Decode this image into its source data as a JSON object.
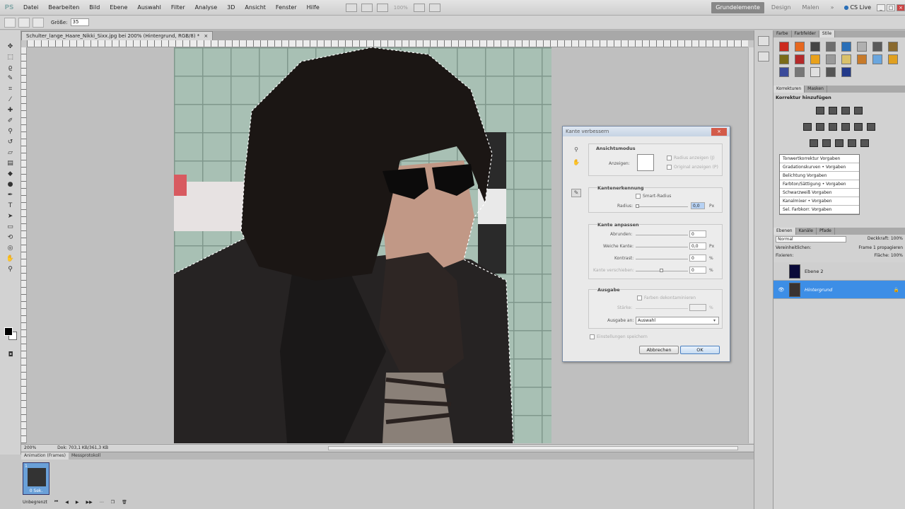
{
  "app": {
    "logo": "PS"
  },
  "menu": [
    "Datei",
    "Bearbeiten",
    "Bild",
    "Ebene",
    "Auswahl",
    "Filter",
    "Analyse",
    "3D",
    "Ansicht",
    "Fenster",
    "Hilfe"
  ],
  "menubar_zoom": "100%",
  "workspaces": {
    "active": "Grundelemente",
    "design": "Design",
    "malen": "Malen",
    "more": "»"
  },
  "cslive": "CS Live",
  "options": {
    "size_label": "Größe:",
    "size_value": "35"
  },
  "document": {
    "tab_title": "Schulter_lange_Haare_Nikki_Sixx.jpg bei 200% (Hintergrund, RGB/8) *",
    "close": "×"
  },
  "status": {
    "zoom": "200%",
    "doc": "Dok: 703,1 KB/361,3 KB"
  },
  "animation": {
    "tabs": [
      "Animation (Frames)",
      "Messprotokoll"
    ],
    "frame_number": "1",
    "frame_time": "0 Sek.",
    "loop": "Unbegrenzt"
  },
  "styles_panel": {
    "tabs": [
      "Farbe",
      "Farbfelder",
      "Stile"
    ],
    "swatch_colors": [
      "#cc2a1e",
      "#e6681f",
      "#444444",
      "#6e6e6e",
      "#2a6fb8",
      "#b0b0b0",
      "#5a5a5a",
      "#8a6a2e",
      "#7a6a18",
      "#b52a2a",
      "#e9a11a",
      "#999999",
      "#d9c16a",
      "#c77a2a",
      "#6aa6de",
      "#e0a020",
      "#3a4a9a",
      "#777777",
      "#e0e0e0",
      "#555555",
      "#223a8a"
    ]
  },
  "korrekturen": {
    "tabs": [
      "Korrekturen",
      "Masken"
    ],
    "title": "Korrektur hinzufügen",
    "presets": [
      "Tonwertkorrektur  Vorgaben",
      "Gradationskurven • Vorgaben",
      "Belichtung  Vorgaben",
      "Farbton/Sättigung • Vorgaben",
      "Schwarzweiß  Vorgaben",
      "Kanalmixer • Vorgaben",
      "Sel. Farbkorr.  Vorgaben"
    ]
  },
  "layers": {
    "tabs": [
      "Ebenen",
      "Kanäle",
      "Pfade"
    ],
    "blend_mode": "Normal",
    "opacity_label": "Deckkraft:",
    "opacity": "100%",
    "lock_label": "Fixieren:",
    "fill_label": "Fläche:",
    "fill": "100%",
    "unify_label": "Vereinheitlichen:",
    "propagate_label": "Frame 1 propagieren",
    "items": [
      {
        "name": "Ebene 2",
        "selected": false
      },
      {
        "name": "Hintergrund",
        "selected": true
      }
    ]
  },
  "dialog": {
    "title": "Kante verbessern",
    "view_mode": {
      "group": "Ansichtsmodus",
      "label": "Anzeigen:",
      "show_radius": "Radius anzeigen (J)",
      "show_original": "Original anzeigen (P)"
    },
    "edge_detection": {
      "group": "Kantenerkennung",
      "smart_radius": "Smart-Radius",
      "radius_label": "Radius:",
      "radius_value": "0,0",
      "unit": "Px"
    },
    "adjust_edge": {
      "group": "Kante anpassen",
      "rows": [
        {
          "label": "Abrunden:",
          "value": "0",
          "unit": ""
        },
        {
          "label": "Weiche Kante:",
          "value": "0,0",
          "unit": "Px"
        },
        {
          "label": "Kontrast:",
          "value": "0",
          "unit": "%"
        },
        {
          "label": "Kante verschieben:",
          "value": "0",
          "unit": "%"
        }
      ]
    },
    "output": {
      "group": "Ausgabe",
      "decontaminate": "Farben dekontaminieren",
      "amount_label": "Stärke:",
      "amount_unit": "%",
      "output_to_label": "Ausgabe an:",
      "output_to_value": "Auswahl"
    },
    "remember": "Einstellungen speichern",
    "cancel": "Abbrechen",
    "ok": "OK"
  }
}
